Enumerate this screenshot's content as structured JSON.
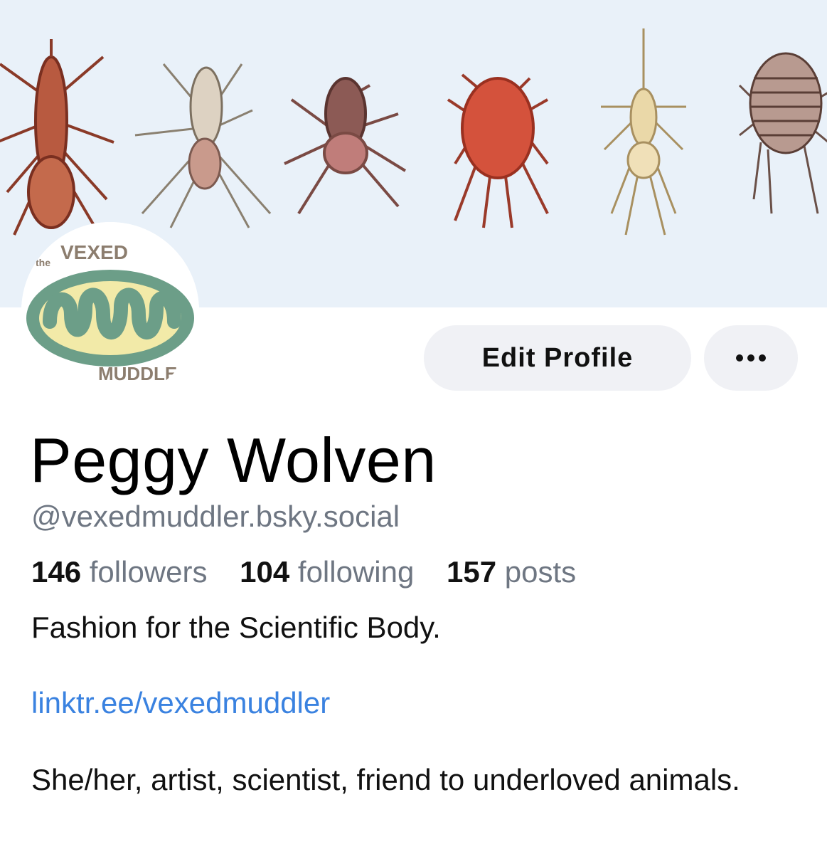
{
  "banner": {
    "description_icon": "mites-illustration"
  },
  "avatar": {
    "logo_text_top_small": "the",
    "logo_text_top": "VEXED",
    "logo_text_bottom": "MUDDLE"
  },
  "actions": {
    "edit_label": "Edit Profile",
    "more_icon": "more-icon"
  },
  "profile": {
    "name": "Peggy Wolven",
    "handle": "@vexedmuddler.bsky.social",
    "stats": {
      "followers_count": "146",
      "followers_label": "followers",
      "following_count": "104",
      "following_label": "following",
      "posts_count": "157",
      "posts_label": "posts"
    },
    "bio_line1": "Fashion for the Scientific Body.",
    "link": "linktr.ee/vexedmuddler",
    "bio_line2": "She/her, artist, scientist, friend to underloved animals."
  },
  "colors": {
    "banner_bg": "#e9f1f9",
    "link": "#3a82e0",
    "muted": "#6e7682",
    "button_bg": "#f0f1f5"
  }
}
